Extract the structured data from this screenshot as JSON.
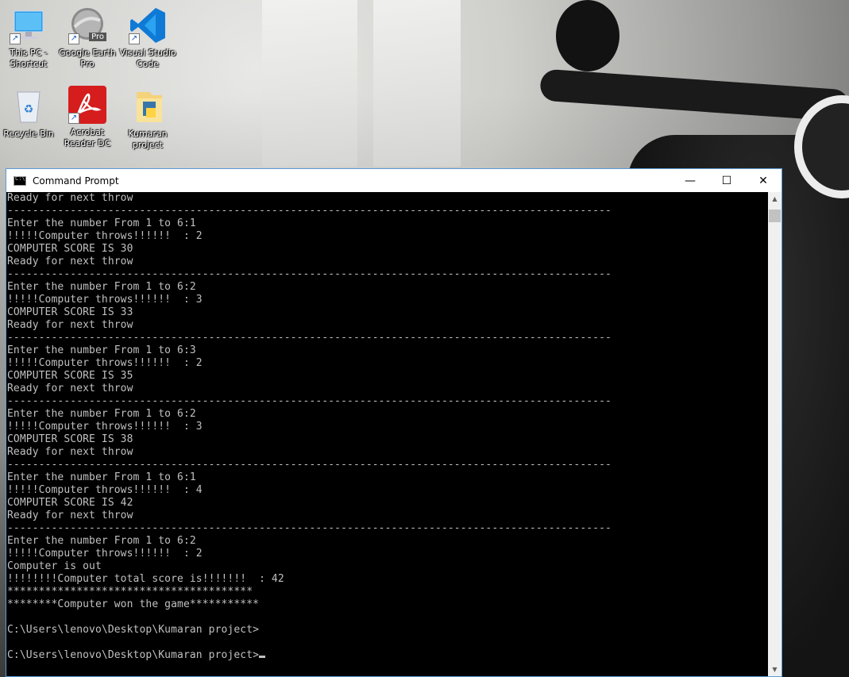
{
  "desktop": {
    "icons": [
      {
        "label_line1": "This PC -",
        "label_line2": "Shortcut"
      },
      {
        "label_line1": "Google Earth",
        "label_line2": "Pro"
      },
      {
        "label_line1": "Visual Studio",
        "label_line2": "Code"
      },
      {
        "label_line1": "Recycle Bin",
        "label_line2": ""
      },
      {
        "label_line1": "Acrobat",
        "label_line2": "Reader DC"
      },
      {
        "label_line1": "Kumaran",
        "label_line2": "project"
      }
    ],
    "google_earth_badge": "Pro"
  },
  "window": {
    "title": "Command Prompt",
    "minimize": "—",
    "maximize": "☐",
    "close": "✕"
  },
  "console": {
    "lines": [
      "Ready for next throw",
      "------------------------------------------------------------------------------------------------",
      "Enter the number From 1 to 6:1",
      "!!!!!Computer throws!!!!!!  : 2",
      "COMPUTER SCORE IS 30",
      "Ready for next throw",
      "------------------------------------------------------------------------------------------------",
      "Enter the number From 1 to 6:2",
      "!!!!!Computer throws!!!!!!  : 3",
      "COMPUTER SCORE IS 33",
      "Ready for next throw",
      "------------------------------------------------------------------------------------------------",
      "Enter the number From 1 to 6:3",
      "!!!!!Computer throws!!!!!!  : 2",
      "COMPUTER SCORE IS 35",
      "Ready for next throw",
      "------------------------------------------------------------------------------------------------",
      "Enter the number From 1 to 6:2",
      "!!!!!Computer throws!!!!!!  : 3",
      "COMPUTER SCORE IS 38",
      "Ready for next throw",
      "------------------------------------------------------------------------------------------------",
      "Enter the number From 1 to 6:1",
      "!!!!!Computer throws!!!!!!  : 4",
      "COMPUTER SCORE IS 42",
      "Ready for next throw",
      "------------------------------------------------------------------------------------------------",
      "Enter the number From 1 to 6:2",
      "!!!!!Computer throws!!!!!!  : 2",
      "Computer is out",
      "!!!!!!!!Computer total score is!!!!!!!  : 42",
      "***************************************",
      "********Computer won the game***********",
      "",
      "C:\\Users\\lenovo\\Desktop\\Kumaran project>",
      "",
      "C:\\Users\\lenovo\\Desktop\\Kumaran project>"
    ]
  },
  "colors": {
    "console_bg": "#000000",
    "console_text": "#c0c0c0",
    "window_border": "#5a9bd6",
    "vscode_blue": "#0f7ad5",
    "acrobat_red": "#d51d1d"
  }
}
